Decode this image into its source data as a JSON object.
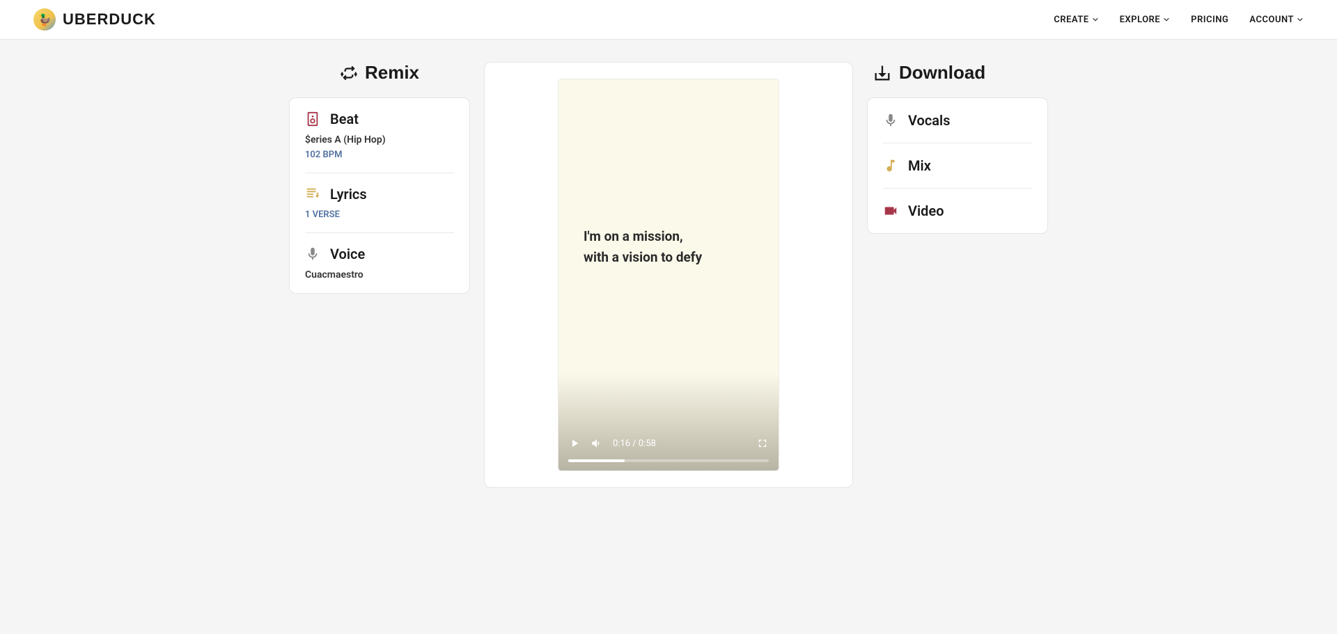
{
  "header": {
    "brand": "UBERDUCK",
    "nav": {
      "create": "CREATE",
      "explore": "EXPLORE",
      "pricing": "PRICING",
      "account": "ACCOUNT"
    }
  },
  "remix": {
    "title": "Remix",
    "beat": {
      "label": "Beat",
      "name": "$eries A (Hip Hop)",
      "bpm": "102 BPM"
    },
    "lyrics": {
      "label": "Lyrics",
      "verse_count": "1 VERSE"
    },
    "voice": {
      "label": "Voice",
      "name": "Cuacmaestro"
    }
  },
  "player": {
    "lyrics_line1": "I'm on a mission,",
    "lyrics_line2": "with a vision to defy",
    "time": "0:16 / 0:58",
    "progress_percent": 28
  },
  "download": {
    "title": "Download",
    "vocals": "Vocals",
    "mix": "Mix",
    "video": "Video"
  }
}
